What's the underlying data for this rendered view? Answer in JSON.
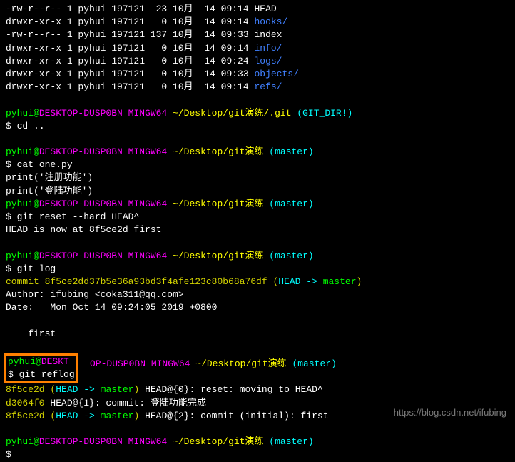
{
  "ls": [
    {
      "perm": "-rw-r--r--",
      "n": "1",
      "user": "pyhui",
      "grp": "197121",
      "size": " 23",
      "mon": "10月",
      "day": "14",
      "time": "09:14",
      "name": "HEAD",
      "type": "file"
    },
    {
      "perm": "drwxr-xr-x",
      "n": "1",
      "user": "pyhui",
      "grp": "197121",
      "size": "  0",
      "mon": "10月",
      "day": "14",
      "time": "09:14",
      "name": "hooks/",
      "type": "dir"
    },
    {
      "perm": "-rw-r--r--",
      "n": "1",
      "user": "pyhui",
      "grp": "197121",
      "size": "137",
      "mon": "10月",
      "day": "14",
      "time": "09:33",
      "name": "index",
      "type": "file"
    },
    {
      "perm": "drwxr-xr-x",
      "n": "1",
      "user": "pyhui",
      "grp": "197121",
      "size": "  0",
      "mon": "10月",
      "day": "14",
      "time": "09:14",
      "name": "info/",
      "type": "dir"
    },
    {
      "perm": "drwxr-xr-x",
      "n": "1",
      "user": "pyhui",
      "grp": "197121",
      "size": "  0",
      "mon": "10月",
      "day": "14",
      "time": "09:24",
      "name": "logs/",
      "type": "dir"
    },
    {
      "perm": "drwxr-xr-x",
      "n": "1",
      "user": "pyhui",
      "grp": "197121",
      "size": "  0",
      "mon": "10月",
      "day": "14",
      "time": "09:33",
      "name": "objects/",
      "type": "dir"
    },
    {
      "perm": "drwxr-xr-x",
      "n": "1",
      "user": "pyhui",
      "grp": "197121",
      "size": "  0",
      "mon": "10月",
      "day": "14",
      "time": "09:14",
      "name": "refs/",
      "type": "dir"
    }
  ],
  "prompt": {
    "user": "pyhui",
    "at": "@",
    "host": "DESKTOP-DUSP0BN",
    "shell": " MINGW64 ",
    "path_git": "~/Desktop/git演练/.git",
    "path_work": "~/Desktop/git演练",
    "branch_gitdir": " (GIT_DIR!)",
    "branch_master": " (master)",
    "ps1": "$ "
  },
  "cmds": {
    "cd": "cd ..",
    "cat": "cat one.py",
    "reset": "git reset --hard HEAD^",
    "log": "git log",
    "reflog": "git reflog"
  },
  "cat_out": {
    "l1": "print('注册功能')",
    "l2": "print('登陆功能')"
  },
  "reset_out": "HEAD is now at 8f5ce2d first",
  "log_out": {
    "commit_prefix": "commit ",
    "commit_hash": "8f5ce2dd37b5e36a93bd3f4afe123c80b68a76df",
    "head_open": " (",
    "head_label": "HEAD -> ",
    "master": "master",
    "head_close": ")",
    "author": "Author: ifubing <coka311@qq.com>",
    "date": "Date:   Mon Oct 14 09:24:05 2019 +0800",
    "msg": "    first"
  },
  "reflog_out": {
    "l1_hash": "8f5ce2d",
    "l1_open": " (",
    "l1_head": "HEAD -> ",
    "l1_master": "master",
    "l1_close": ") ",
    "l1_rest": "HEAD@{0}: reset: moving to HEAD^",
    "l2_hash": "d3064f0",
    "l2_rest": " HEAD@{1}: commit: 登陆功能完成",
    "l3_hash": "8f5ce2d",
    "l3_open": " (",
    "l3_head": "HEAD -> ",
    "l3_master": "master",
    "l3_close": ") ",
    "l3_rest": "HEAD@{2}: commit (initial): first"
  },
  "watermark": "https://blog.csdn.net/ifubing"
}
